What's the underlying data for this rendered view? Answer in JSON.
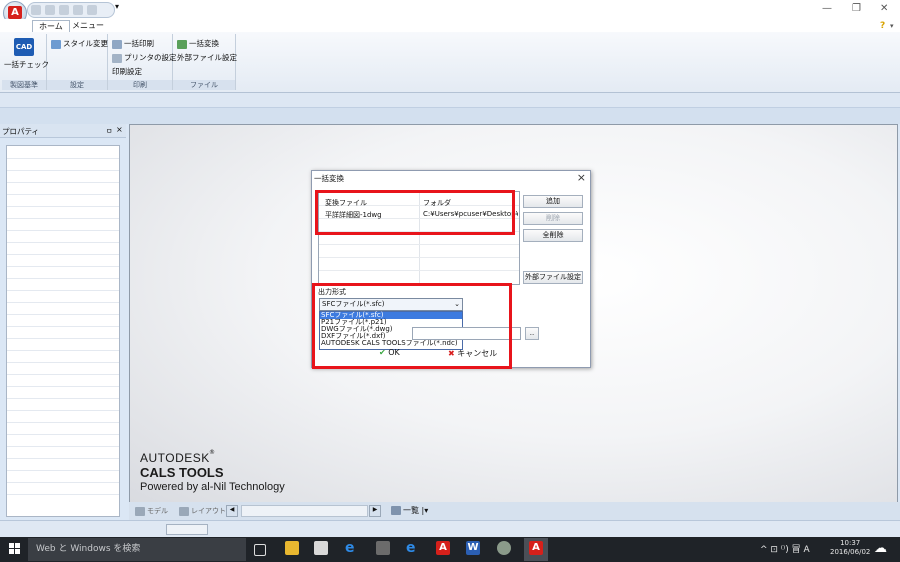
{
  "tabs": {
    "home": "ホーム",
    "menu": "メニュー"
  },
  "ribbon": {
    "check_label": "一括チェック",
    "group_standard": "製図基準",
    "style_change": "スタイル変更",
    "group_settings": "設定",
    "batch_print": "一括印刷",
    "printer_settings": "プリンタの設定",
    "print_settings": "印刷設定",
    "group_print": "印刷",
    "batch_convert": "一括変換",
    "external_file_settings": "外部ファイル設定",
    "group_file": "ファイル"
  },
  "properties": {
    "title": "プロパティ",
    "pin": "ㅁ",
    "close": "×"
  },
  "brand": {
    "line1": "AUTODESK",
    "line2": "CALS TOOLS",
    "line3": "Powered by al-Nil Technology"
  },
  "bottom_tabs": {
    "model": "モデル",
    "layout": "レイアウト",
    "list": "一覧"
  },
  "dialog": {
    "title": "一括変換",
    "close": "×",
    "col_file": "変換ファイル",
    "col_folder": "フォルダ",
    "row_file": "平詳詳細図-1dwg",
    "row_folder": "C:¥Users¥pcuser¥Desktop¥",
    "add": "追加",
    "remove": "削除",
    "remove_all": "全削除",
    "external_settings": "外部ファイル設定",
    "output_format_label": "出力形式",
    "selected_format": "SFCファイル(*.sfc)",
    "options": [
      "SFCファイル(*.sfc)",
      "P21ファイル(*.p21)",
      "DWGファイル(*.dwg)",
      "DXFファイル(*.dxf)",
      "AUTODESK CALS TOOLSファイル(*.ndc)"
    ],
    "browse": "..",
    "ok": "OK",
    "cancel": "キャンセル"
  },
  "taskbar": {
    "search_placeholder": "Web と Windows を検索",
    "tray_text": "^ ⊡ ⁽⁾) 冒 A",
    "time": "10:37",
    "date": "2016/06/02"
  },
  "colors": {
    "highlight_red": "#e8141b",
    "selection_blue": "#3d7be0",
    "taskbar": "#1f2328"
  }
}
